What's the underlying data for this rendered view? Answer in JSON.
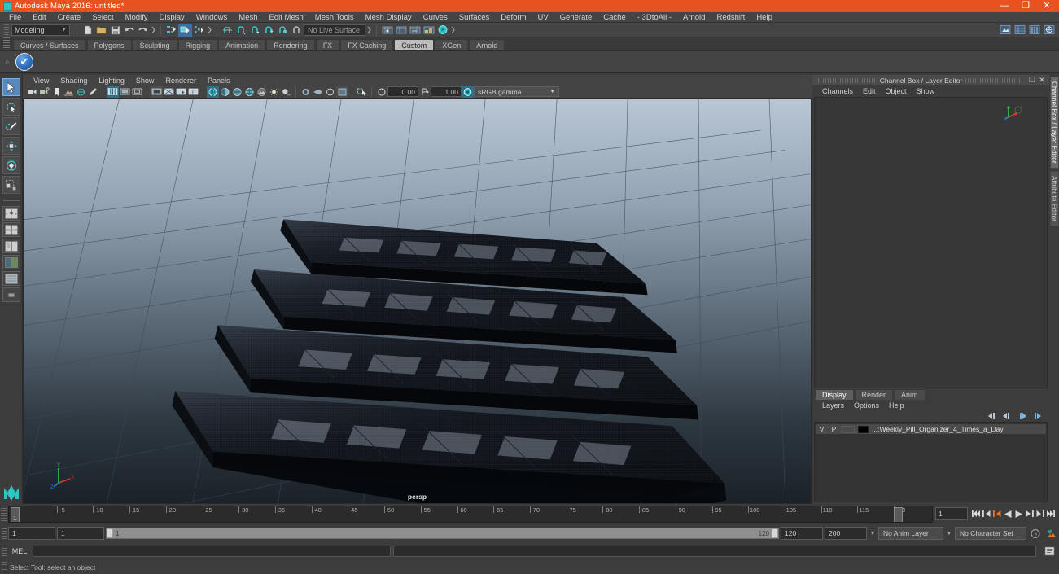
{
  "window": {
    "title": "Autodesk Maya 2016: untitled*",
    "app_icon": "maya-icon",
    "buttons": {
      "minimize": "—",
      "maximize": "❐",
      "close": "✕"
    }
  },
  "menubar": {
    "items": [
      "File",
      "Edit",
      "Create",
      "Select",
      "Modify",
      "Display",
      "Windows",
      "Mesh",
      "Edit Mesh",
      "Mesh Tools",
      "Mesh Display",
      "Curves",
      "Surfaces",
      "Deform",
      "UV",
      "Generate",
      "Cache",
      "- 3DtoAll -",
      "Arnold",
      "Redshift",
      "Help"
    ]
  },
  "statusline": {
    "menuset": "Modeling",
    "live_surface": "No Live Surface",
    "icons_file": [
      "new-scene-icon",
      "open-scene-icon",
      "save-scene-icon",
      "undo-icon",
      "redo-icon"
    ],
    "icons_selectmode": [
      "select-by-hierarchy-icon",
      "select-by-object-icon",
      "select-by-component-icon"
    ],
    "icons_snap": [
      "snap-to-grid-icon",
      "snap-to-curve-icon",
      "snap-to-point-icon",
      "snap-to-projected-center-icon",
      "snap-to-view-plane-icon",
      "make-live-icon"
    ],
    "icons_editors": [
      "show-hide-attribute-editor-icon",
      "show-hide-tool-settings-icon",
      "show-hide-channel-box-icon",
      "render-view-icon"
    ],
    "icons_right": [
      "render-current-frame-icon",
      "ipr-render-icon",
      "render-settings-icon",
      "hypershade-icon"
    ]
  },
  "shelf": {
    "tabs": [
      "Curves / Surfaces",
      "Polygons",
      "Sculpting",
      "Rigging",
      "Animation",
      "Rendering",
      "FX",
      "FX Caching",
      "Custom",
      "XGen",
      "Arnold"
    ],
    "active_tab": "Custom",
    "item_icon": "blue-check-shelf-icon"
  },
  "toolbox": {
    "tools": [
      {
        "name": "select-tool",
        "active": true
      },
      {
        "name": "lasso-select-tool",
        "active": false
      },
      {
        "name": "paint-select-tool",
        "active": false
      },
      {
        "name": "move-tool",
        "active": false
      },
      {
        "name": "rotate-tool",
        "active": false
      },
      {
        "name": "scale-tool",
        "active": false
      },
      {
        "name": "last-tool-used",
        "active": false
      }
    ],
    "layouts": [
      "single-perspective-layout",
      "four-view-layout",
      "two-pane-side-layout",
      "two-pane-stacked-layout",
      "persp-outliner-layout",
      "more-layouts"
    ],
    "logo": "maya-logo"
  },
  "viewport": {
    "menus": [
      "View",
      "Shading",
      "Lighting",
      "Show",
      "Renderer",
      "Panels"
    ],
    "toolbar_icons": [
      "select-camera-icon",
      "camera-attributes-icon",
      "bookmark-icon",
      "image-plane-icon",
      "two-d-pan-zoom-icon",
      "grease-pencil-icon",
      "grid-icon",
      "film-gate-icon",
      "resolution-gate-icon",
      "gate-mask-icon",
      "film-origin-icon",
      "safe-action-icon",
      "safe-title-icon",
      "wireframe-icon",
      "smooth-shade-icon",
      "flat-shade-icon",
      "wireframe-on-shaded-icon",
      "texture-icon",
      "lighting-icon",
      "shadows-icon",
      "screen-space-ao-icon",
      "motion-blur-icon",
      "multisample-icon",
      "depth-of-field-icon",
      "isolate-select-icon",
      "panel-zoom-icon"
    ],
    "exposure_value": "0.00",
    "gamma_value": "1.00",
    "color_management": "sRGB gamma",
    "camera_label": "persp",
    "axis_labels": {
      "x": "X",
      "y": "Y",
      "z": "Z"
    }
  },
  "channel_box": {
    "panel_title": "Channel Box / Layer Editor",
    "undock_icon": "undock-icon",
    "close_icon": "close-icon",
    "menus": [
      "Channels",
      "Edit",
      "Object",
      "Show"
    ],
    "manipulator_icon": "channel-box-manipulator-icon"
  },
  "layer_editor": {
    "tabs": [
      "Display",
      "Render",
      "Anim"
    ],
    "active_tab": "Display",
    "menus": [
      "Layers",
      "Options",
      "Help"
    ],
    "toolbar_icons": [
      "layer-move-first-icon",
      "layer-move-up-icon",
      "layer-move-down-icon",
      "layer-move-last-icon"
    ],
    "layers": [
      {
        "visibility": "V",
        "playback": "P",
        "type": "",
        "color": "#000000",
        "name": "...:Weekly_Pill_Organizer_4_Times_a_Day"
      }
    ]
  },
  "side_tabs": {
    "items": [
      "Channel Box / Layer Editor",
      "Attribute Editor"
    ],
    "active": "Channel Box / Layer Editor"
  },
  "time_slider": {
    "tick_labels": [
      "5",
      "10",
      "15",
      "20",
      "25",
      "30",
      "35",
      "40",
      "45",
      "50",
      "55",
      "60",
      "65",
      "70",
      "75",
      "80",
      "85",
      "90",
      "95",
      "100",
      "105",
      "110",
      "115",
      "120"
    ],
    "current_frame": "1",
    "end_marker": "120",
    "frame_field": "1",
    "playback_buttons": [
      "go-to-start-icon",
      "step-back-keyframe-icon",
      "step-back-frame-icon",
      "play-backwards-icon",
      "play-forwards-icon",
      "step-forward-frame-icon",
      "step-forward-keyframe-icon",
      "go-to-end-icon"
    ],
    "highlighted_button": "step-back-frame-icon"
  },
  "range_slider": {
    "start_field": "1",
    "range_start_field": "1",
    "bar_start_label": "1",
    "bar_end_label": "120",
    "range_end_field": "120",
    "end_field": "200",
    "anim_layer": "No Anim Layer",
    "character_set": "No Character Set",
    "auto_key_icon": "auto-keyframe-icon",
    "anim_prefs_icon": "animation-preferences-icon"
  },
  "command_line": {
    "label": "MEL",
    "value": "",
    "input_placeholder": "",
    "script_editor_icon": "script-editor-icon"
  },
  "help_line": {
    "text": "Select Tool: select an object"
  },
  "colors": {
    "accent_orange": "#e8521f",
    "panel_bg": "#3c3c3c",
    "toolbar_bg": "#444444",
    "field_bg": "#2b2b2b",
    "highlight_blue": "#5a88bb",
    "viewport_top": "#b8c6d4",
    "viewport_bottom": "#1b2229"
  }
}
